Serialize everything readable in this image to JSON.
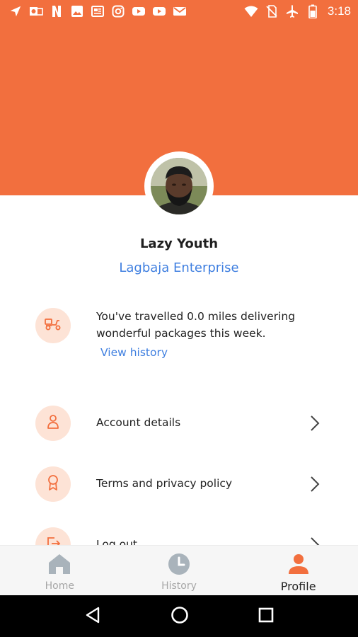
{
  "status_bar": {
    "time": "3:18",
    "left_icons": [
      "navigation-icon",
      "outlook-icon",
      "netflix-icon",
      "image-icon",
      "news-icon",
      "instagram-icon",
      "youtube-icon",
      "youtube-icon",
      "gmail-icon"
    ],
    "right_icons": [
      "wifi-icon",
      "no-sim-icon",
      "airplane-mode-icon",
      "battery-icon"
    ]
  },
  "colors": {
    "accent": "#f26f3e",
    "accent_light": "#fde3d6",
    "link": "#3f7fe0"
  },
  "profile": {
    "name": "Lazy Youth",
    "company": "Lagbaja Enterprise"
  },
  "travel": {
    "icon": "delivery-scooter-icon",
    "message": "You've travelled 0.0 miles delivering wonderful packages this week.",
    "link_label": "View history"
  },
  "menu": [
    {
      "icon": "user-icon",
      "label": "Account details"
    },
    {
      "icon": "award-ribbon-icon",
      "label": "Terms and privacy policy"
    },
    {
      "icon": "logout-icon",
      "label": "Log out"
    }
  ],
  "bottom_nav": {
    "active": "Profile",
    "items": [
      {
        "icon": "home-icon",
        "label": "Home"
      },
      {
        "icon": "clock-icon",
        "label": "History"
      },
      {
        "icon": "person-icon",
        "label": "Profile"
      }
    ]
  },
  "system_nav": [
    "back-icon",
    "home-circle-icon",
    "recents-icon"
  ]
}
